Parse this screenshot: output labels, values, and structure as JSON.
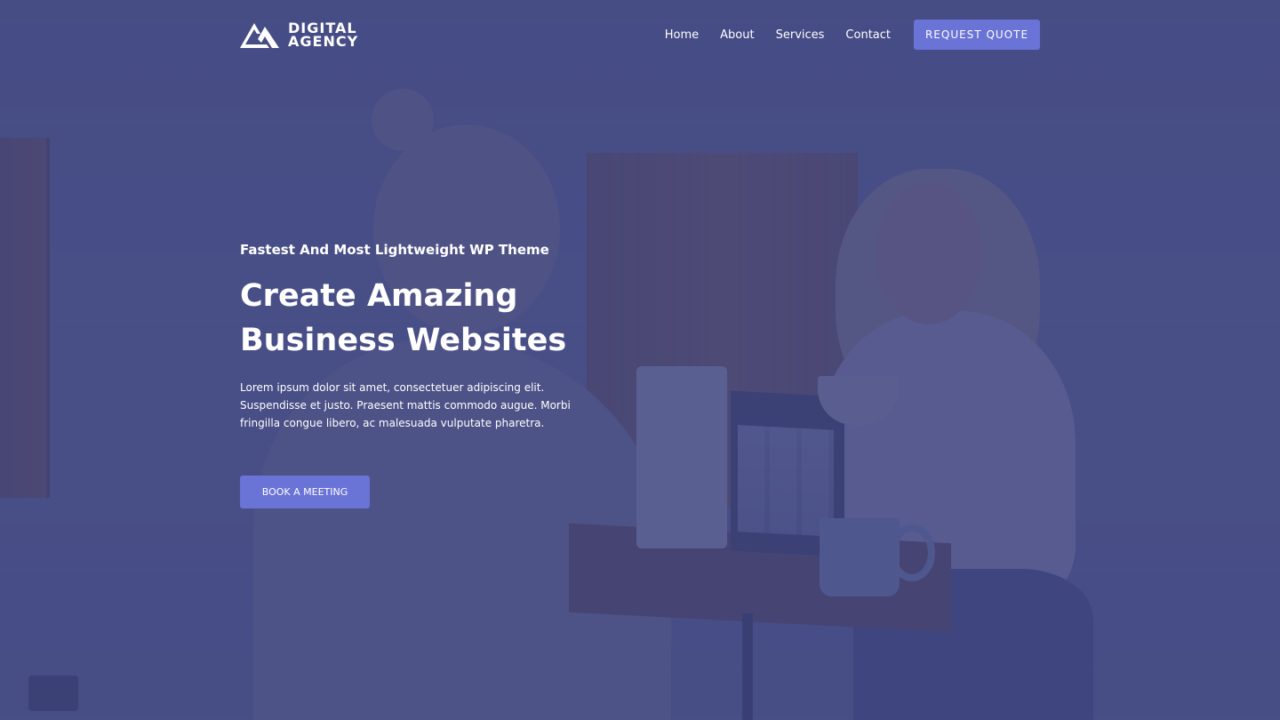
{
  "brand": {
    "line1": "DIGITAL",
    "line2": "AGENCY",
    "icon": "mountain-logo-icon"
  },
  "nav": {
    "items": [
      {
        "label": "Home"
      },
      {
        "label": "About"
      },
      {
        "label": "Services"
      },
      {
        "label": "Contact"
      }
    ],
    "cta_label": "REQUEST QUOTE"
  },
  "hero": {
    "eyebrow": "Fastest And Most Lightweight WP Theme",
    "headline_line1": "Create Amazing",
    "headline_line2": "Business Websites",
    "description": "Lorem ipsum dolor sit amet, consectetuer adipiscing elit. Suspendisse et justo. Praesent mattis commodo augue. Morbi fringilla congue libero, ac malesuada vulputate pharetra.",
    "cta_label": "BOOK A MEETING"
  },
  "colors": {
    "accent": "#6a73d6",
    "overlay": "#3e4480",
    "text": "#ffffff"
  }
}
